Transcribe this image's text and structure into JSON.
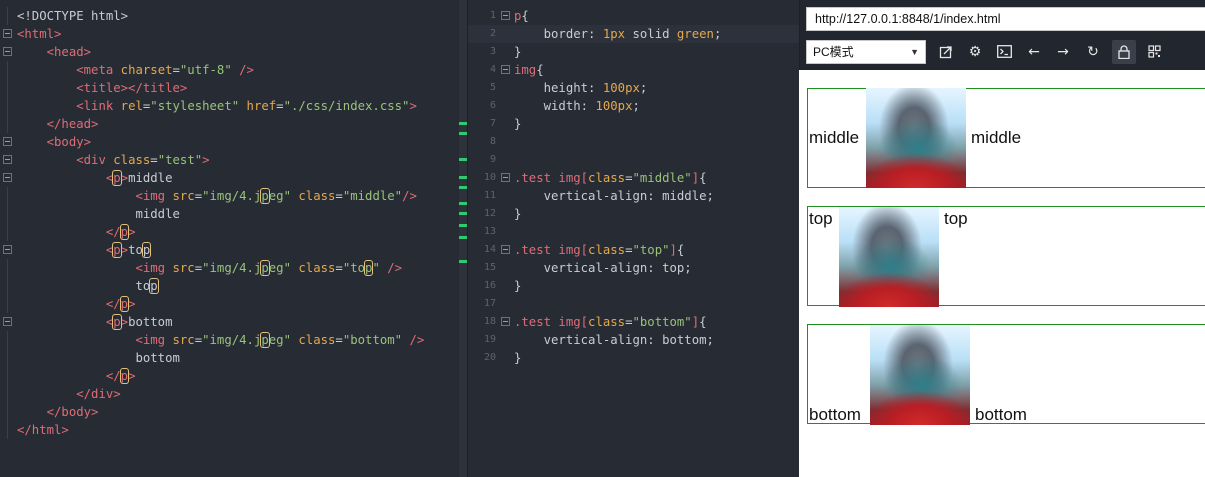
{
  "html_editor": {
    "lines": [
      {
        "fold": false,
        "html": "<span class='t-doc'>&lt;!DOCTYPE html&gt;</span>"
      },
      {
        "fold": true,
        "html": "<span class='t-tag'>&lt;html&gt;</span>"
      },
      {
        "fold": true,
        "html": "    <span class='t-tag'>&lt;head&gt;</span>"
      },
      {
        "fold": false,
        "html": "        <span class='t-tag'>&lt;meta</span> <span class='t-attr'>charset</span>=<span class='t-str'>\"utf-8\"</span> <span class='t-tag'>/&gt;</span>"
      },
      {
        "fold": false,
        "html": "        <span class='t-tag'>&lt;title&gt;&lt;/title&gt;</span>"
      },
      {
        "fold": false,
        "html": "        <span class='t-tag'>&lt;link</span> <span class='t-attr'>rel</span>=<span class='t-str'>\"stylesheet\"</span> <span class='t-attr'>href</span>=<span class='t-str'>\"./css/index.css\"</span><span class='t-tag'>&gt;</span>"
      },
      {
        "fold": false,
        "html": "    <span class='t-tag'>&lt;/head&gt;</span>"
      },
      {
        "fold": true,
        "html": "    <span class='t-tag'>&lt;body&gt;</span>"
      },
      {
        "fold": true,
        "html": "        <span class='t-tag'>&lt;div</span> <span class='t-attr'>class</span>=<span class='t-str'>\"test\"</span><span class='t-tag'>&gt;</span>"
      },
      {
        "fold": true,
        "html": "            <span class='t-tag'>&lt;<span class='hl'>p</span>&gt;</span><span class='t-text'>middle</span>"
      },
      {
        "fold": false,
        "html": "                <span class='t-tag'>&lt;img</span> <span class='t-attr'>src</span>=<span class='t-str'>\"img/4.j<span class='hl'>p</span>eg\"</span> <span class='t-attr'>class</span>=<span class='t-str'>\"middle\"</span><span class='t-tag'>/&gt;</span>"
      },
      {
        "fold": false,
        "html": "                <span class='t-text'>middle</span>"
      },
      {
        "fold": false,
        "html": "            <span class='t-tag'>&lt;/<span class='hl'>p</span>&gt;</span>"
      },
      {
        "fold": true,
        "html": "            <span class='t-tag'>&lt;<span class='hl'>p</span>&gt;</span><span class='t-text'>to<span class='hl'>p</span></span>"
      },
      {
        "fold": false,
        "html": "                <span class='t-tag'>&lt;img</span> <span class='t-attr'>src</span>=<span class='t-str'>\"img/4.j<span class='hl'>p</span>eg\"</span> <span class='t-attr'>class</span>=<span class='t-str'>\"to<span class='hl'>p</span>\"</span> <span class='t-tag'>/&gt;</span>"
      },
      {
        "fold": false,
        "html": "                <span class='t-text'>to<span class='hl'>p</span></span>"
      },
      {
        "fold": false,
        "html": "            <span class='t-tag'>&lt;/<span class='hl'>p</span>&gt;</span>"
      },
      {
        "fold": true,
        "html": "            <span class='t-tag'>&lt;<span class='hl'>p</span>&gt;</span><span class='t-text'>bottom</span>"
      },
      {
        "fold": false,
        "html": "                <span class='t-tag'>&lt;img</span> <span class='t-attr'>src</span>=<span class='t-str'>\"img/4.j<span class='hl'>p</span>eg\"</span> <span class='t-attr'>class</span>=<span class='t-str'>\"bottom\"</span> <span class='t-tag'>/&gt;</span>"
      },
      {
        "fold": false,
        "html": "                <span class='t-text'>bottom</span>"
      },
      {
        "fold": false,
        "html": "            <span class='t-tag'>&lt;/<span class='hl'>p</span>&gt;</span>"
      },
      {
        "fold": false,
        "html": "        <span class='t-tag'>&lt;/div&gt;</span>"
      },
      {
        "fold": false,
        "html": "    <span class='t-tag'>&lt;/body&gt;</span>"
      },
      {
        "fold": false,
        "html": "<span class='t-tag'>&lt;/html&gt;</span>"
      }
    ]
  },
  "css_editor": {
    "active_line": 2,
    "lines": [
      {
        "n": "1",
        "fold": true,
        "html": "<span class='t-sel'>p</span>{"
      },
      {
        "n": "2",
        "fold": false,
        "html": "    <span class='t-prop'>border</span>: <span class='t-num'>1px</span> solid <span class='t-kw'>green</span>;"
      },
      {
        "n": "3",
        "fold": false,
        "html": "}"
      },
      {
        "n": "4",
        "fold": true,
        "html": "<span class='t-sel'>img</span>{"
      },
      {
        "n": "5",
        "fold": false,
        "html": "    <span class='t-prop'>height</span>: <span class='t-num'>100px</span>;"
      },
      {
        "n": "6",
        "fold": false,
        "html": "    <span class='t-prop'>width</span>: <span class='t-num'>100px</span>;"
      },
      {
        "n": "7",
        "fold": false,
        "html": "}"
      },
      {
        "n": "8",
        "fold": false,
        "html": ""
      },
      {
        "n": "9",
        "fold": false,
        "html": ""
      },
      {
        "n": "10",
        "fold": true,
        "html": "<span class='t-sel'>.test img</span><span class='t-tag'>[</span><span class='t-attr'>class</span>=<span class='t-str'>\"middle\"</span><span class='t-tag'>]</span>{"
      },
      {
        "n": "11",
        "fold": false,
        "html": "    <span class='t-prop'>vertical-align</span>: middle;"
      },
      {
        "n": "12",
        "fold": false,
        "html": "}"
      },
      {
        "n": "13",
        "fold": false,
        "html": ""
      },
      {
        "n": "14",
        "fold": true,
        "html": "<span class='t-sel'>.test img</span><span class='t-tag'>[</span><span class='t-attr'>class</span>=<span class='t-str'>\"top\"</span><span class='t-tag'>]</span>{"
      },
      {
        "n": "15",
        "fold": false,
        "html": "    <span class='t-prop'>vertical-align</span>: top;"
      },
      {
        "n": "16",
        "fold": false,
        "html": "}"
      },
      {
        "n": "17",
        "fold": false,
        "html": ""
      },
      {
        "n": "18",
        "fold": true,
        "html": "<span class='t-sel'>.test img</span><span class='t-tag'>[</span><span class='t-attr'>class</span>=<span class='t-str'>\"bottom\"</span><span class='t-tag'>]</span>{"
      },
      {
        "n": "19",
        "fold": false,
        "html": "    <span class='t-prop'>vertical-align</span>: bottom;"
      },
      {
        "n": "20",
        "fold": false,
        "html": "}"
      }
    ]
  },
  "browser": {
    "url": "http://127.0.0.1:8848/1/index.html",
    "mode": "PC模式",
    "tools": [
      "external-link-icon",
      "gear-icon",
      "terminal-icon",
      "arrow-left-icon",
      "arrow-right-icon",
      "refresh-icon",
      "lock-icon",
      "grid-icon"
    ]
  },
  "preview": {
    "p1": {
      "left": "middle",
      "right": "middle"
    },
    "p2": {
      "left": "top",
      "right": "top"
    },
    "p3": {
      "left": "bottom",
      "right": "bottom"
    }
  },
  "colors": {
    "editor_bg": "#272b34",
    "border_green": "#1f8f1f",
    "change_marker": "#2ecc71"
  }
}
